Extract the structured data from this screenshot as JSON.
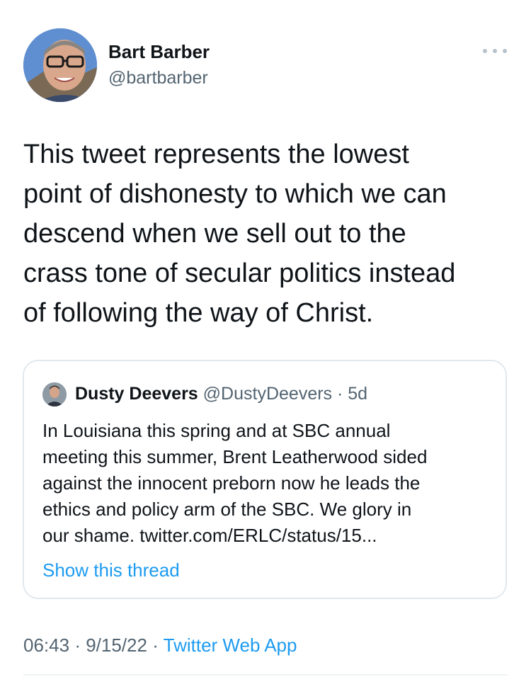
{
  "author": {
    "name": "Bart Barber",
    "handle": "@bartbarber"
  },
  "tweet": {
    "lines": [
      "This tweet represents the lowest",
      "point of dishonesty to which we can",
      "descend when we sell out to the",
      "crass tone of secular politics instead",
      "of following the way of Christ."
    ]
  },
  "quote": {
    "name": "Dusty Deevers",
    "handle": "@DustyDeevers",
    "separator": "·",
    "age": "5d",
    "lines": [
      "In Louisiana this spring and at SBC annual",
      "meeting this summer, Brent Leatherwood sided",
      "against the innocent preborn now he leads the",
      "ethics and policy arm of the SBC. We glory in",
      "our shame. twitter.com/ERLC/status/15..."
    ],
    "show_thread": "Show this thread"
  },
  "meta": {
    "time": "06:43",
    "sep1": "·",
    "date": "9/15/22",
    "sep2": "·",
    "source": "Twitter Web App"
  },
  "icons": {
    "more": "more-horizontal-icon"
  },
  "colors": {
    "link": "#1d9bf0",
    "secondary_text": "#536471",
    "border": "#e1e8ed"
  }
}
